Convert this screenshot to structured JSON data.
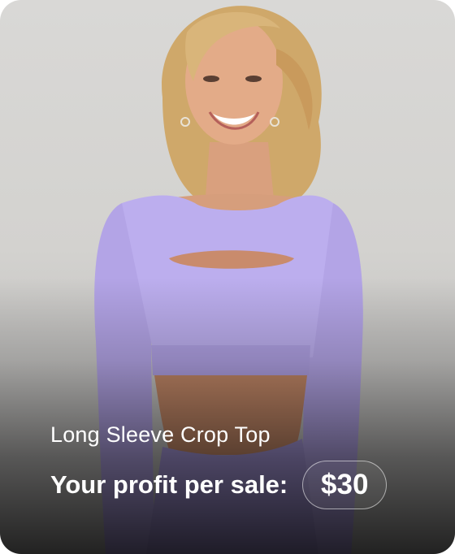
{
  "product": {
    "name": "Long Sleeve Crop Top",
    "profit_label": "Your profit per sale:",
    "profit_value": "$30"
  }
}
